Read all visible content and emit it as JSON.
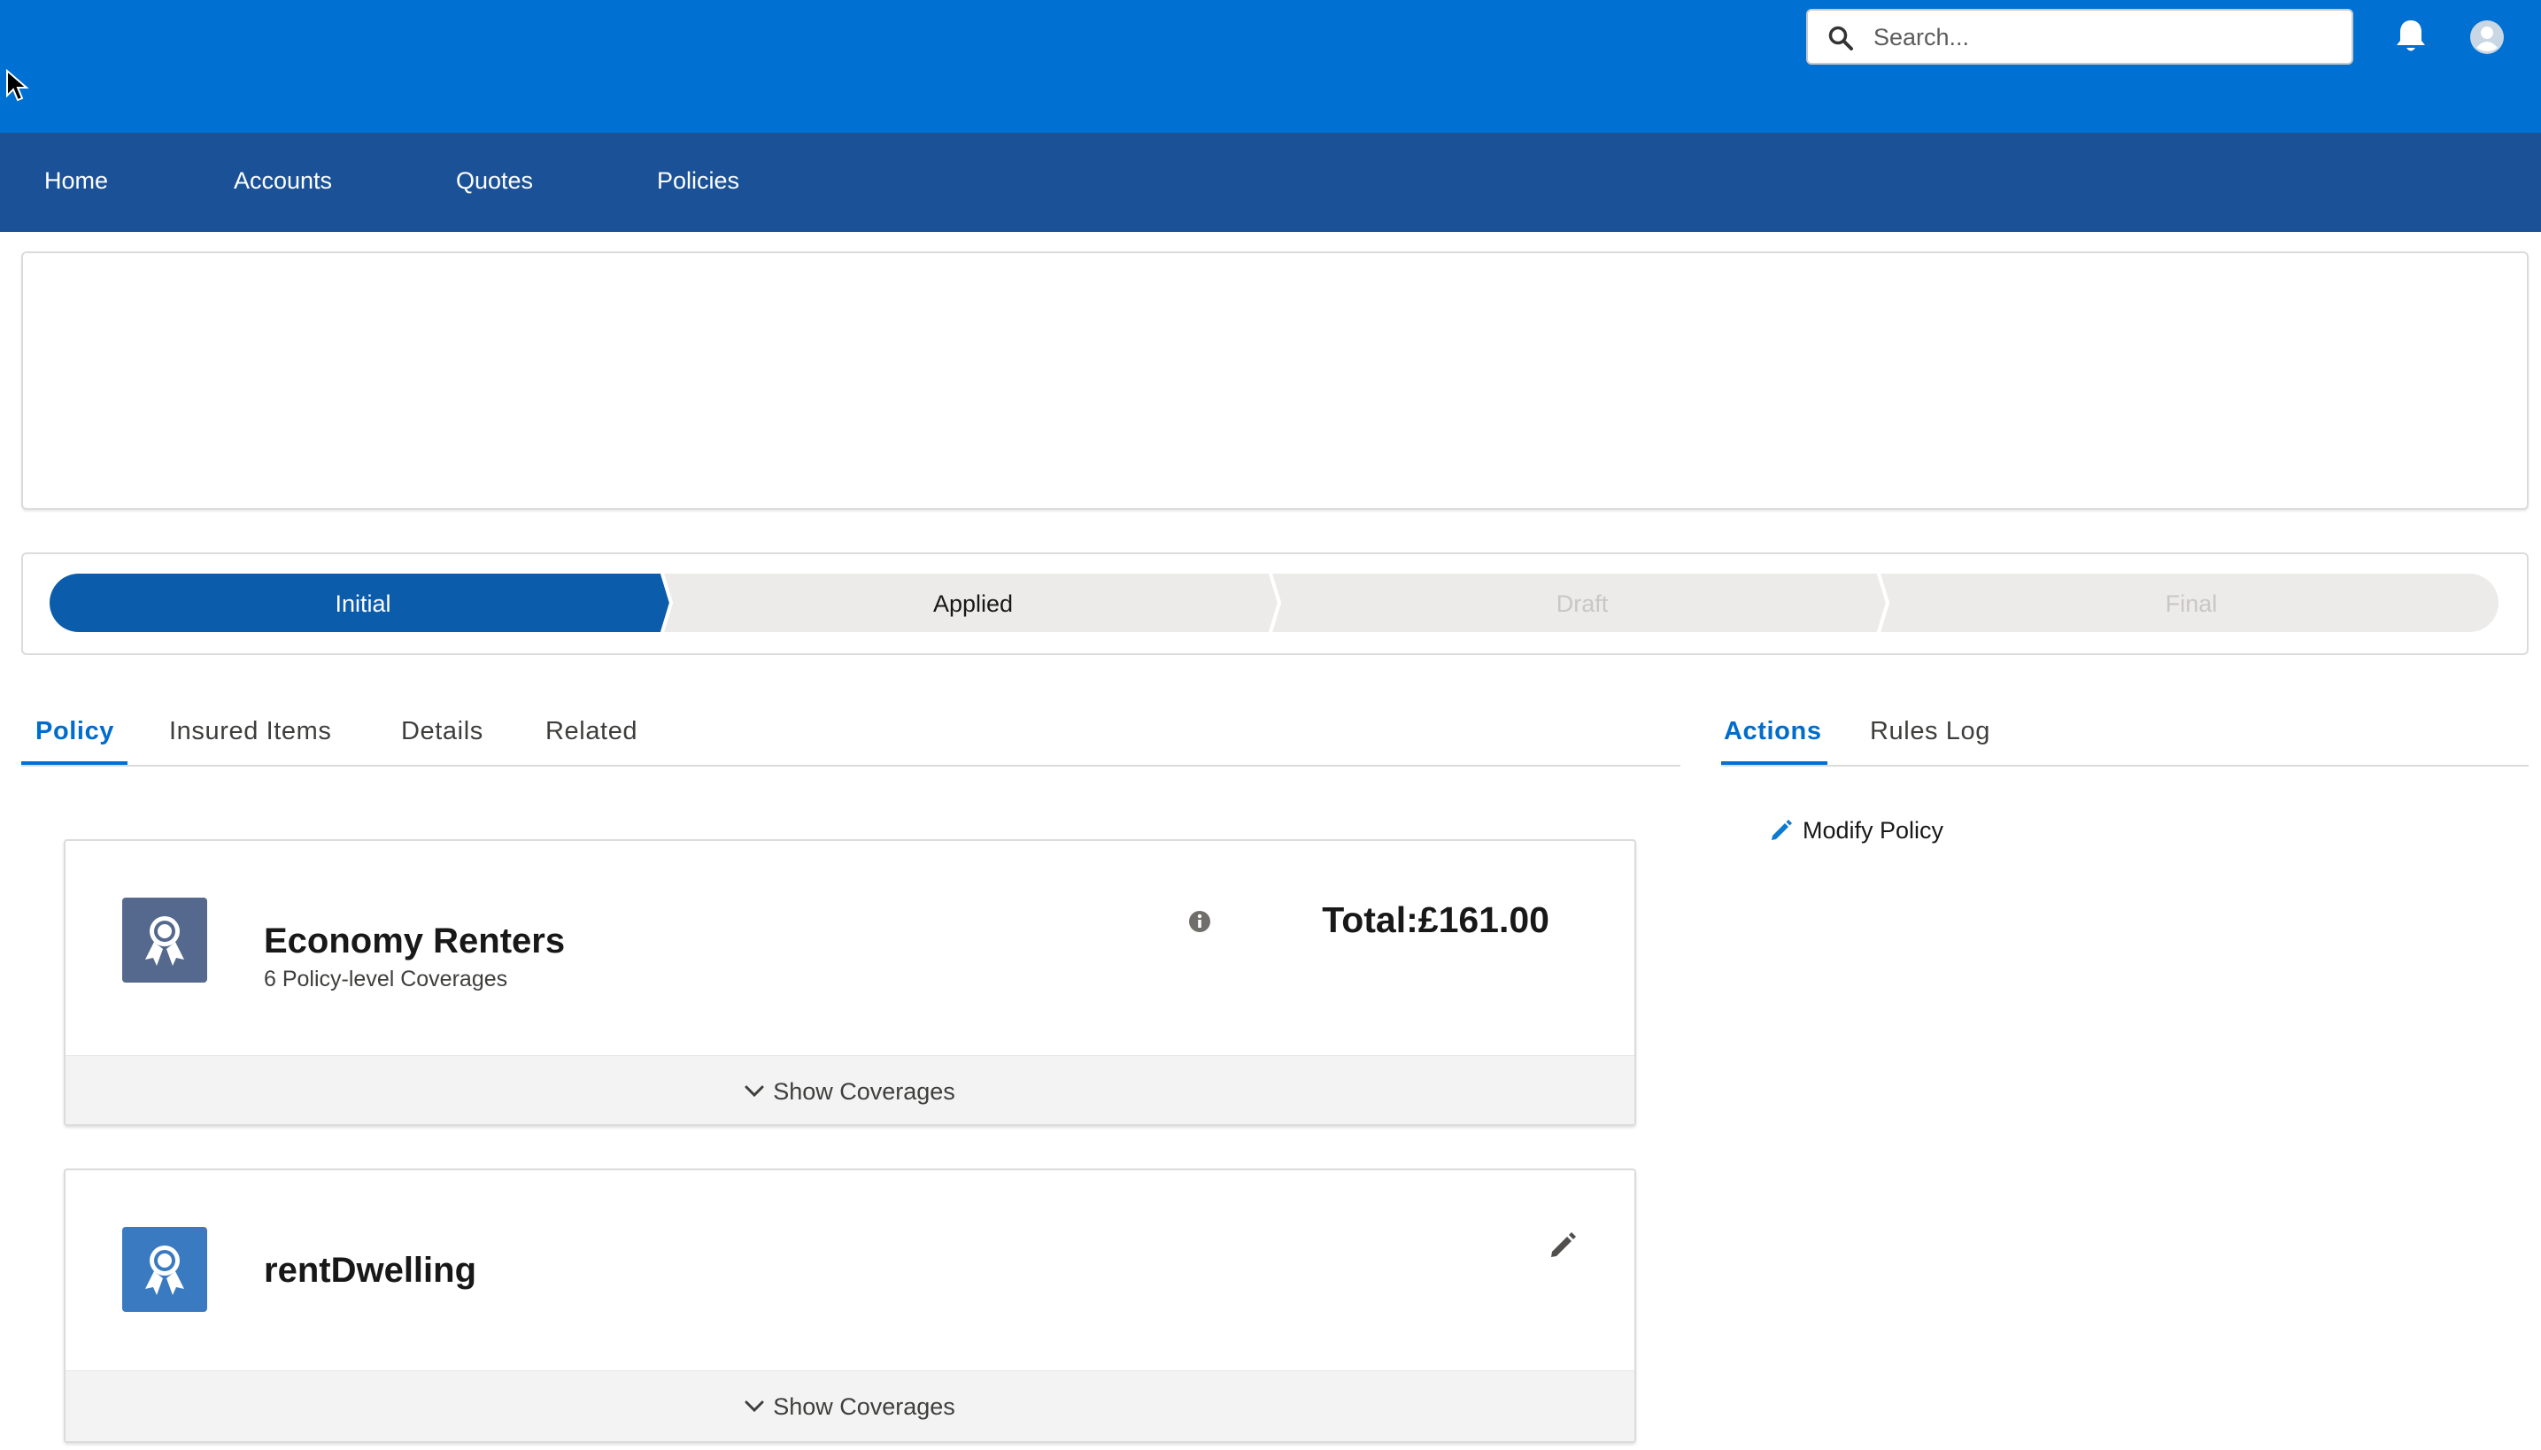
{
  "header": {
    "search_placeholder": "Search..."
  },
  "nav": {
    "items": [
      "Home",
      "Accounts",
      "Quotes",
      "Policies"
    ]
  },
  "path": {
    "stages": [
      {
        "label": "Initial",
        "state": "current"
      },
      {
        "label": "Applied",
        "state": "next"
      },
      {
        "label": "Draft",
        "state": "disabled"
      },
      {
        "label": "Final",
        "state": "disabled"
      }
    ]
  },
  "tabs": {
    "main": [
      "Policy",
      "Insured Items",
      "Details",
      "Related"
    ],
    "main_active": "Policy",
    "side": [
      "Actions",
      "Rules Log"
    ],
    "side_active": "Actions"
  },
  "actions": {
    "modify_label": "Modify Policy"
  },
  "products": [
    {
      "name": "Economy Renters",
      "subtitle": "6 Policy-level Coverages",
      "total": "Total:£161.00",
      "show_label": "Show Coverages"
    },
    {
      "name": "rentDwelling",
      "show_label": "Show Coverages"
    }
  ],
  "colors": {
    "brand": "#0070d2",
    "nav": "#1b5297",
    "product_icon_primary": "#54698d",
    "product_icon_secondary": "#3a7ac0"
  },
  "icons": {
    "search": "search-icon",
    "bell": "bell-icon",
    "avatar": "user-avatar-icon",
    "pencil": "pencil-icon",
    "info": "info-icon",
    "chevron": "chevron-down-icon",
    "award": "award-ribbon-icon"
  }
}
